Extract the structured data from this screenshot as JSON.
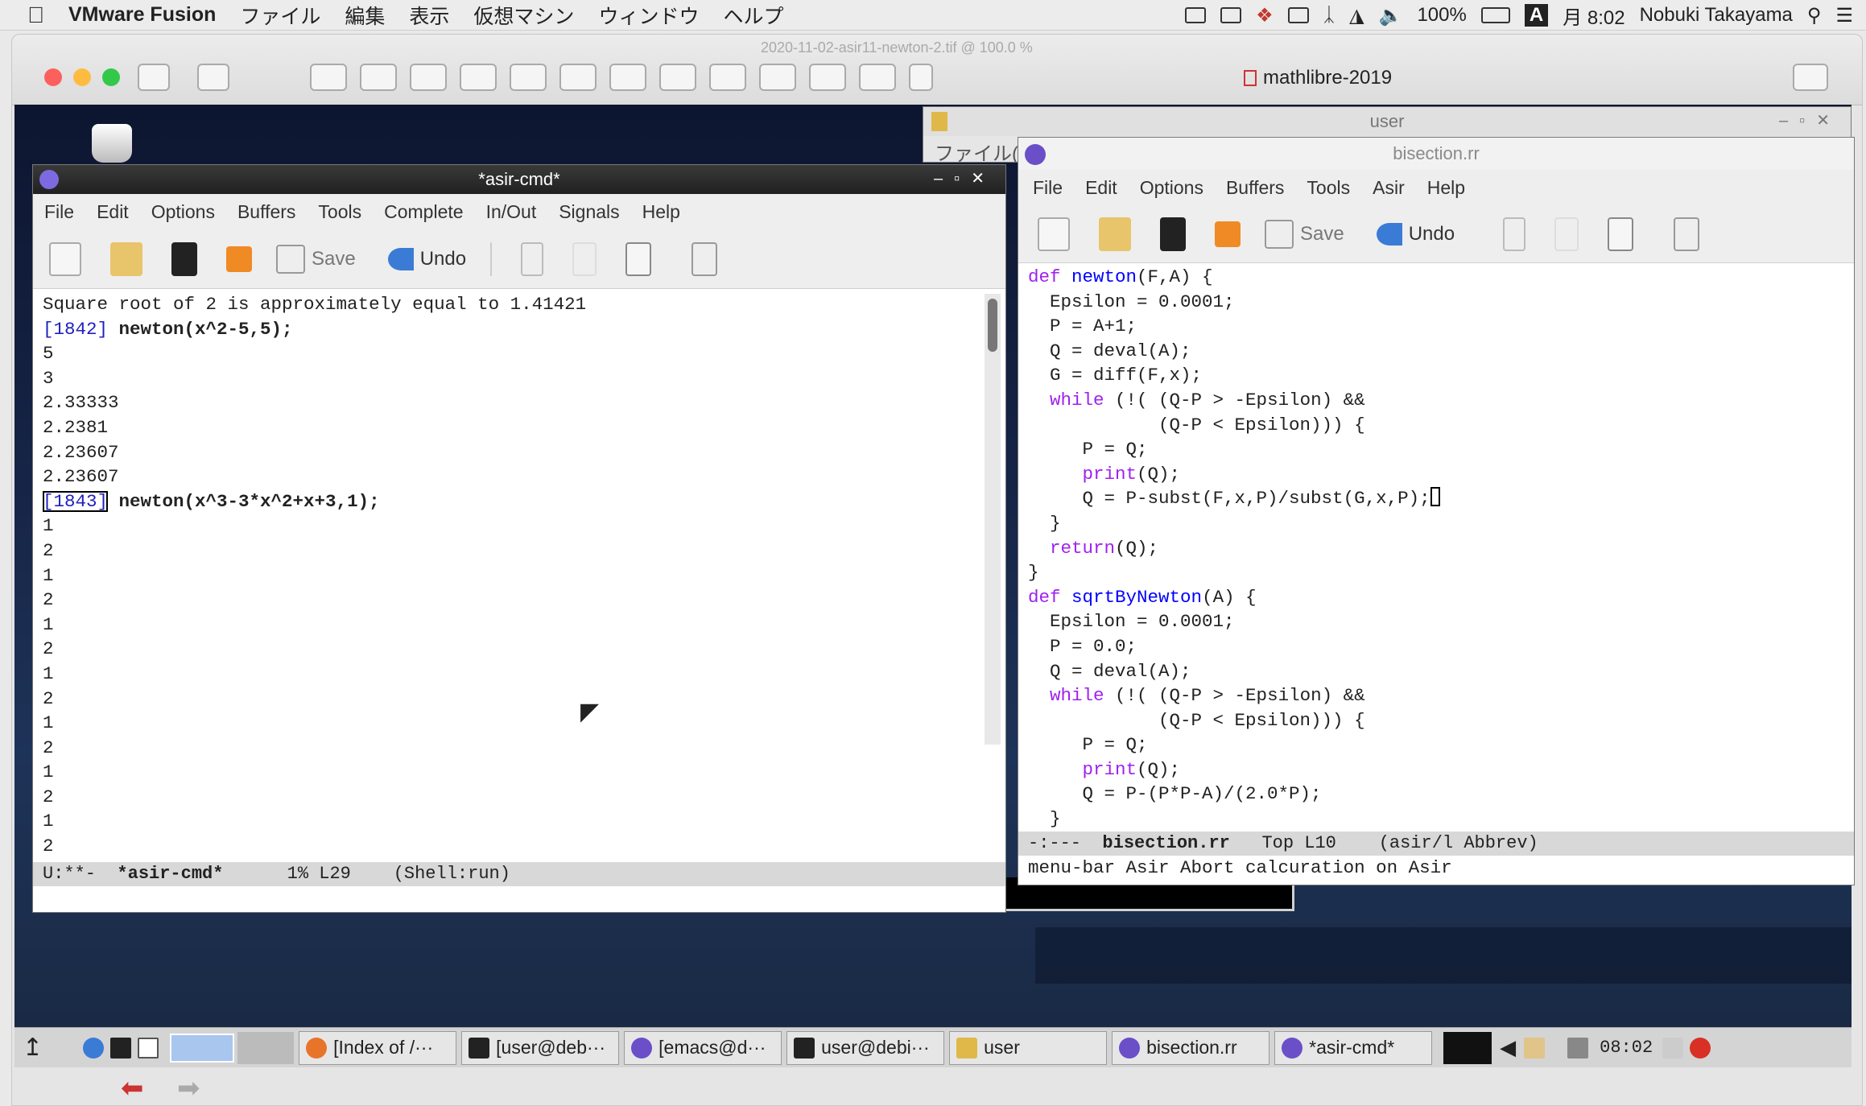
{
  "mac_menubar": {
    "app": "VMware Fusion",
    "menus": [
      "ファイル",
      "編集",
      "表示",
      "仮想マシン",
      "ウィンドウ",
      "ヘルプ"
    ],
    "battery": "100%",
    "input_source": "A",
    "clock": "月 8:02",
    "user": "Nobuki Takayama"
  },
  "fusion": {
    "title": "mathlibre-2019",
    "faded_title": "2020-11-02-asir11-newton-2.tif @ 100.0 %"
  },
  "user_window": {
    "title": "user",
    "menu_fragment": "ファイル("
  },
  "asir_cmd": {
    "title": "*asir-cmd*",
    "menus": [
      "File",
      "Edit",
      "Options",
      "Buffers",
      "Tools",
      "Complete",
      "In/Out",
      "Signals",
      "Help"
    ],
    "toolbar": {
      "save": "Save",
      "undo": "Undo"
    },
    "lines": [
      {
        "text": "Square root of 2 is approximately equal to 1.41421"
      },
      {
        "prompt": "[1842]",
        "text": " newton(x^2-5,5);"
      },
      {
        "text": "5"
      },
      {
        "text": "3"
      },
      {
        "text": "2.33333"
      },
      {
        "text": "2.2381"
      },
      {
        "text": "2.23607"
      },
      {
        "text": "2.23607"
      },
      {
        "prompt": "[1843]",
        "text": " newton(x^3-3*x^2+x+3,1);"
      },
      {
        "text": "1"
      },
      {
        "text": "2"
      },
      {
        "text": "1"
      },
      {
        "text": "2"
      },
      {
        "text": "1"
      },
      {
        "text": "2"
      },
      {
        "text": "1"
      },
      {
        "text": "2"
      },
      {
        "text": "1"
      },
      {
        "text": "2"
      },
      {
        "text": "1"
      },
      {
        "text": "2"
      },
      {
        "text": "1"
      },
      {
        "text": "2"
      }
    ],
    "modeline": {
      "status": "U:**-",
      "buffer": "*asir-cmd*",
      "pos": "1% L29",
      "mode": "(Shell:run)"
    }
  },
  "bisection": {
    "title": "bisection.rr",
    "menus": [
      "File",
      "Edit",
      "Options",
      "Buffers",
      "Tools",
      "Asir",
      "Help"
    ],
    "toolbar": {
      "save": "Save",
      "undo": "Undo"
    },
    "code": [
      [
        {
          "t": "def",
          "c": "kw"
        },
        {
          "t": " "
        },
        {
          "t": "newton",
          "c": "fn"
        },
        {
          "t": "(F,A) {"
        }
      ],
      [
        {
          "t": "  Epsilon = 0.0001;"
        }
      ],
      [
        {
          "t": "  P = A+1;"
        }
      ],
      [
        {
          "t": "  Q = deval(A);"
        }
      ],
      [
        {
          "t": "  G = diff(F,x);"
        }
      ],
      [
        {
          "t": "  "
        },
        {
          "t": "while",
          "c": "kw"
        },
        {
          "t": " (!( (Q-P > -Epsilon) &&"
        }
      ],
      [
        {
          "t": "            (Q-P < Epsilon))) {"
        }
      ],
      [
        {
          "t": "     P = Q;"
        }
      ],
      [
        {
          "t": "     "
        },
        {
          "t": "print",
          "c": "kw"
        },
        {
          "t": "(Q);"
        }
      ],
      [
        {
          "t": "     Q = P-subst(F,x,P)/subst(G,x,P);"
        },
        {
          "t": " ",
          "c": "cursor"
        }
      ],
      [
        {
          "t": "  }"
        }
      ],
      [
        {
          "t": "  "
        },
        {
          "t": "return",
          "c": "kw"
        },
        {
          "t": "(Q);"
        }
      ],
      [
        {
          "t": "}"
        }
      ],
      [
        {
          "t": "def",
          "c": "kw"
        },
        {
          "t": " "
        },
        {
          "t": "sqrtByNewton",
          "c": "fn"
        },
        {
          "t": "(A) {"
        }
      ],
      [
        {
          "t": "  Epsilon = 0.0001;"
        }
      ],
      [
        {
          "t": "  P = 0.0;"
        }
      ],
      [
        {
          "t": "  Q = deval(A);"
        }
      ],
      [
        {
          "t": "  "
        },
        {
          "t": "while",
          "c": "kw"
        },
        {
          "t": " (!( (Q-P > -Epsilon) &&"
        }
      ],
      [
        {
          "t": "            (Q-P < Epsilon))) {"
        }
      ],
      [
        {
          "t": "     P = Q;"
        }
      ],
      [
        {
          "t": "     "
        },
        {
          "t": "print",
          "c": "kw"
        },
        {
          "t": "(Q);"
        }
      ],
      [
        {
          "t": "     Q = P-(P*P-A)/(2.0*P);"
        }
      ],
      [
        {
          "t": "  }"
        }
      ]
    ],
    "modeline": {
      "status": "-:---",
      "buffer": "bisection.rr",
      "pos": "Top L10",
      "mode": "(asir/l Abbrev)"
    },
    "echo": "menu-bar Asir Abort calcuration on Asir"
  },
  "taskbar": {
    "buttons": [
      {
        "label": "[Index of /···",
        "icon": "firefox-icon",
        "color": "#e8742a"
      },
      {
        "label": "[user@deb···",
        "icon": "terminal-icon",
        "color": "#222222"
      },
      {
        "label": "[emacs@d···",
        "icon": "emacs-icon",
        "color": "#6a4fc8"
      },
      {
        "label": "user@debi···",
        "icon": "terminal-icon",
        "color": "#222222"
      },
      {
        "label": "user",
        "icon": "folder-icon",
        "color": "#e0b84a"
      },
      {
        "label": "bisection.rr",
        "icon": "emacs-icon",
        "color": "#6a4fc8"
      },
      {
        "label": "*asir-cmd*",
        "icon": "emacs-icon",
        "color": "#6a4fc8"
      }
    ],
    "clock": "08:02"
  }
}
